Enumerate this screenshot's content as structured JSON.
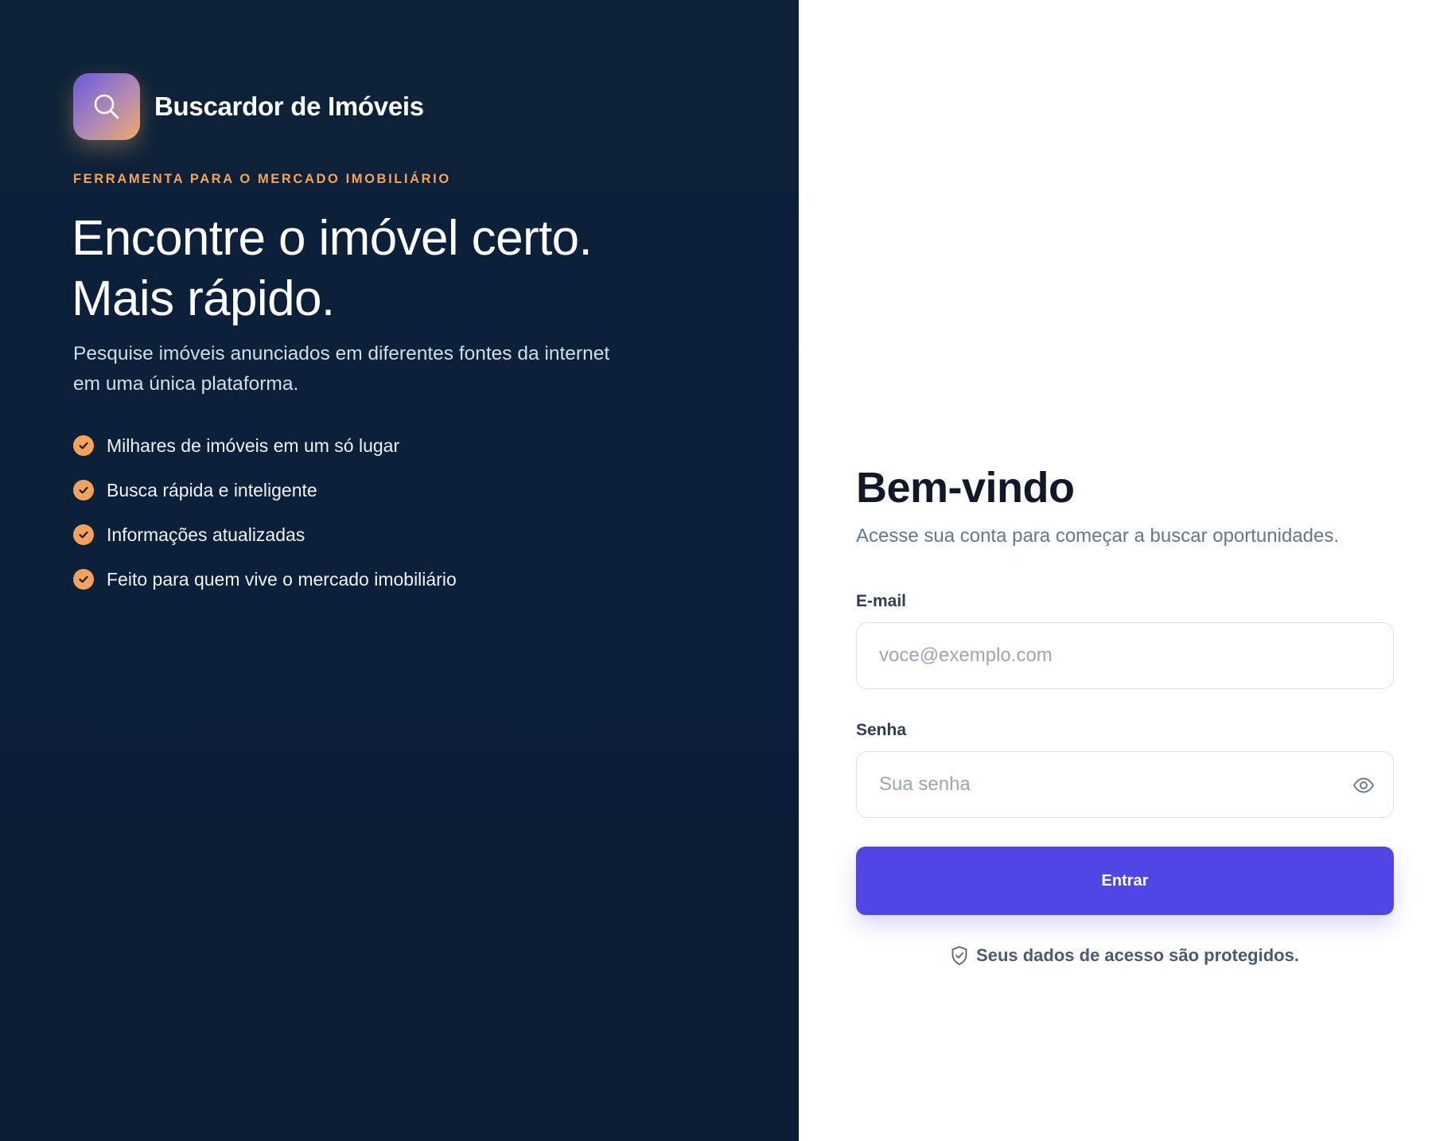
{
  "brand": {
    "name": "Buscardor de Imóveis",
    "logo_icon": "search-icon",
    "logo_gradient": [
      "#6b57e0",
      "#f0a868"
    ]
  },
  "hero": {
    "kicker": "FERRAMENTA PARA O MERCADO IMOBILIÁRIO",
    "headline_line1": "Encontre o imóvel certo.",
    "headline_line2": "Mais rápido.",
    "subtitle": "Pesquise imóveis anunciados em diferentes fontes da internet em uma única plataforma.",
    "features": [
      {
        "label": "Milhares de imóveis em um só lugar",
        "icon": "check-circle-icon"
      },
      {
        "label": "Busca rápida e inteligente",
        "icon": "check-circle-icon"
      },
      {
        "label": "Informações atualizadas",
        "icon": "check-circle-icon"
      },
      {
        "label": "Feito para quem vive o mercado imobiliário",
        "icon": "check-circle-icon"
      }
    ]
  },
  "login": {
    "title": "Bem-vindo",
    "subtitle": "Acesse sua conta para começar a buscar oportunidades.",
    "email_label": "E-mail",
    "email_placeholder": "voce@exemplo.com",
    "email_value": "",
    "password_label": "Senha",
    "password_placeholder": "Sua senha",
    "password_value": "",
    "password_toggle_icon": "eye-icon",
    "submit_label": "Entrar",
    "security_icon": "shield-check-icon",
    "security_note": "Seus dados de acesso são protegidos."
  },
  "colors": {
    "left_panel_bg": "#0c203a",
    "accent_orange": "#f5a35a",
    "primary_button": "#4f46e5",
    "heading_dark": "#111827",
    "muted_text": "#5f7894"
  }
}
